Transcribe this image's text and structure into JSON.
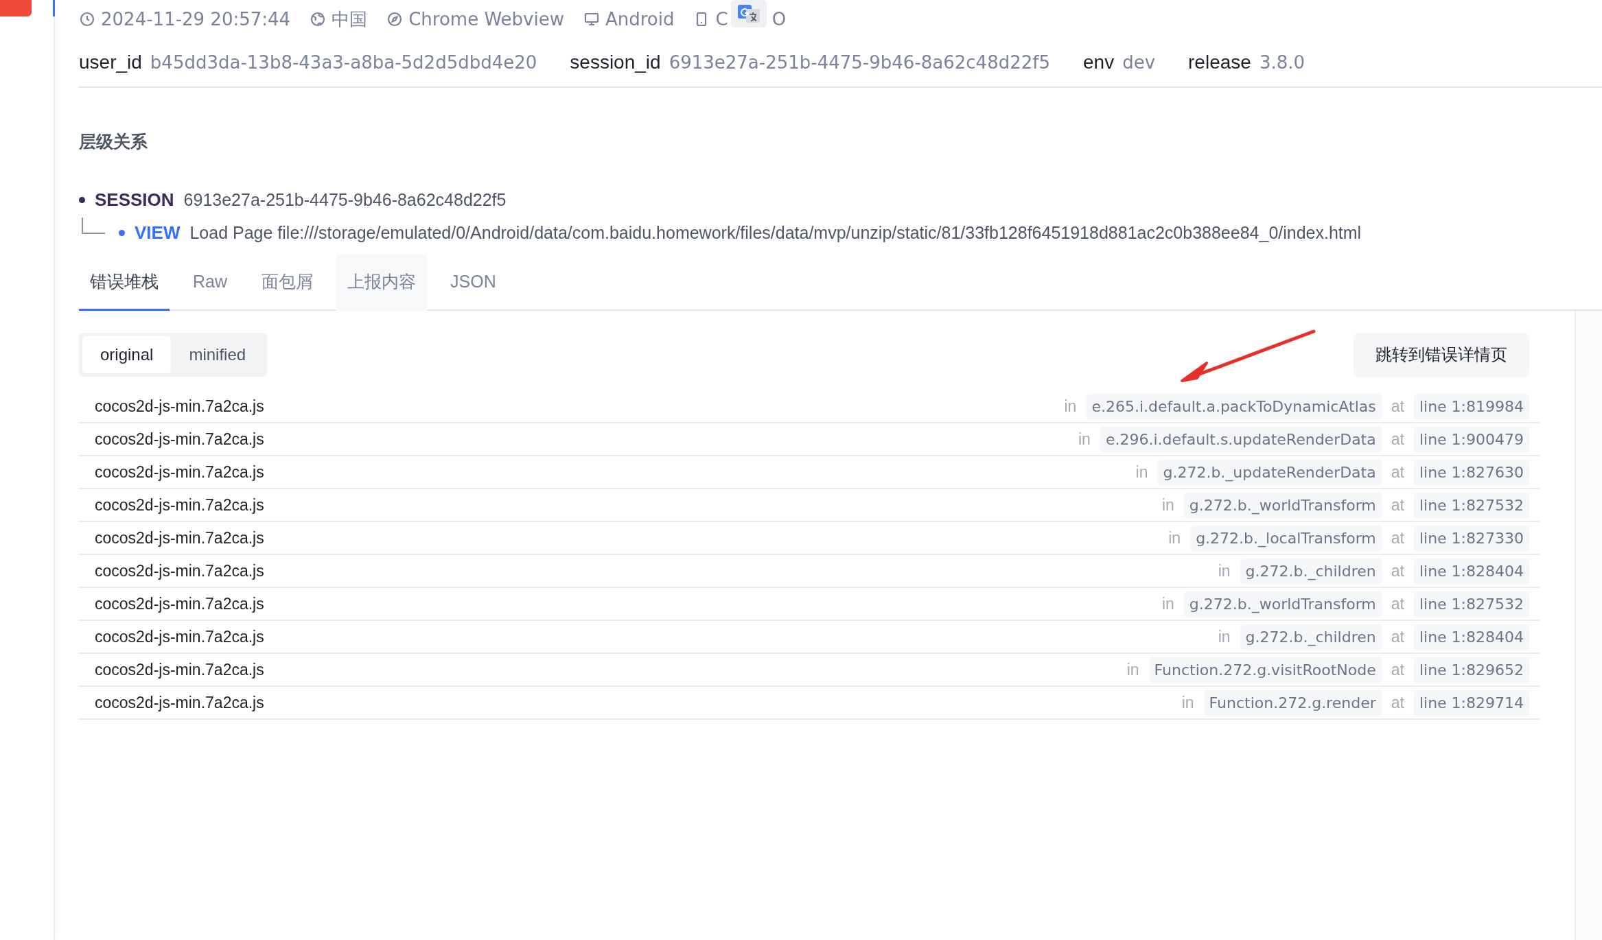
{
  "meta": [
    {
      "kind": "clock",
      "text": "2024-11-29 20:57:44"
    },
    {
      "kind": "globe",
      "text": "中国"
    },
    {
      "kind": "compass",
      "text": "Chrome Webview"
    },
    {
      "kind": "monitor",
      "text": "Android"
    },
    {
      "kind": "device",
      "text": "C",
      "after": "O"
    }
  ],
  "fields": [
    {
      "label": "user_id",
      "value": "b45dd3da-13b8-43a3-a8ba-5d2d5dbd4e20"
    },
    {
      "label": "session_id",
      "value": "6913e27a-251b-4475-9b46-8a62c48d22f5"
    },
    {
      "label": "env",
      "value": "dev"
    },
    {
      "label": "release",
      "value": "3.8.0"
    }
  ],
  "hierarchy": {
    "title": "层级关系",
    "nodes": [
      {
        "type": "SESSION",
        "text": "6913e27a-251b-4475-9b46-8a62c48d22f5",
        "color": "#3d2a5c",
        "children": [
          {
            "type": "VIEW",
            "text": "Load Page file:///storage/emulated/0/Android/data/com.baidu.homework/files/data/mvp/unzip/static/81/33fb128f6451918d881ac2c0b388ee84_0/index.html",
            "color": "#3370ff"
          }
        ]
      }
    ]
  },
  "tabs": [
    {
      "label": "错误堆栈",
      "selected": true,
      "hovered": false
    },
    {
      "label": "Raw",
      "selected": false,
      "hovered": false
    },
    {
      "label": "面包屑",
      "selected": false,
      "hovered": false
    },
    {
      "label": "上报内容",
      "selected": false,
      "hovered": true
    },
    {
      "label": "JSON",
      "selected": false,
      "hovered": false
    }
  ],
  "modes": [
    {
      "label": "original",
      "selected": true
    },
    {
      "label": "minified",
      "selected": false
    }
  ],
  "jump_button": "跳转到错误详情页",
  "frames": [
    {
      "file": "cocos2d-js-min.7a2ca.js",
      "in": "in",
      "fn": "e.265.i.default.a.packToDynamicAtlas",
      "at": "at",
      "line": "line 1:819984"
    },
    {
      "file": "cocos2d-js-min.7a2ca.js",
      "in": "in",
      "fn": "e.296.i.default.s.updateRenderData",
      "at": "at",
      "line": "line 1:900479"
    },
    {
      "file": "cocos2d-js-min.7a2ca.js",
      "in": "in",
      "fn": "g.272.b._updateRenderData",
      "at": "at",
      "line": "line 1:827630"
    },
    {
      "file": "cocos2d-js-min.7a2ca.js",
      "in": "in",
      "fn": "g.272.b._worldTransform",
      "at": "at",
      "line": "line 1:827532"
    },
    {
      "file": "cocos2d-js-min.7a2ca.js",
      "in": "in",
      "fn": "g.272.b._localTransform",
      "at": "at",
      "line": "line 1:827330"
    },
    {
      "file": "cocos2d-js-min.7a2ca.js",
      "in": "in",
      "fn": "g.272.b._children",
      "at": "at",
      "line": "line 1:828404"
    },
    {
      "file": "cocos2d-js-min.7a2ca.js",
      "in": "in",
      "fn": "g.272.b._worldTransform",
      "at": "at",
      "line": "line 1:827532"
    },
    {
      "file": "cocos2d-js-min.7a2ca.js",
      "in": "in",
      "fn": "g.272.b._children",
      "at": "at",
      "line": "line 1:828404"
    },
    {
      "file": "cocos2d-js-min.7a2ca.js",
      "in": "in",
      "fn": "Function.272.g.visitRootNode",
      "at": "at",
      "line": "line 1:829652"
    },
    {
      "file": "cocos2d-js-min.7a2ca.js",
      "in": "in",
      "fn": "Function.272.g.render",
      "at": "at",
      "line": "line 1:829714"
    }
  ]
}
